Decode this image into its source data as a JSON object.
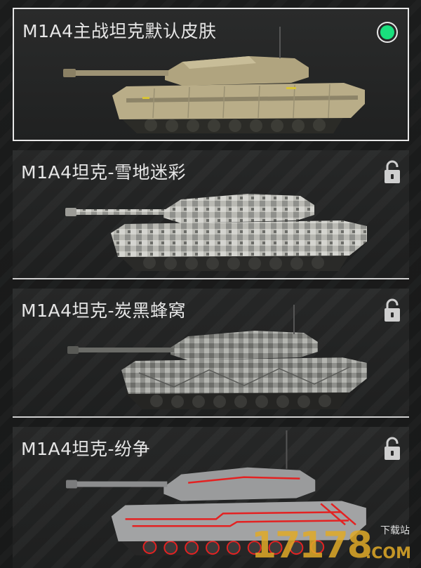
{
  "skins": [
    {
      "name": "M1A4主战坦克默认皮肤",
      "state": "selected",
      "camo": "desert"
    },
    {
      "name": "M1A4坦克-雪地迷彩",
      "state": "locked",
      "camo": "snow-digital"
    },
    {
      "name": "M1A4坦克-炭黑蜂窝",
      "state": "locked",
      "camo": "charcoal-honeycomb"
    },
    {
      "name": "M1A4坦克-纷争",
      "state": "locked",
      "camo": "strife-red-lines"
    }
  ],
  "colors": {
    "selected_indicator": "#19e07d",
    "selected_border": "#e7e7e7",
    "desert_hull": "#b9ad88",
    "snow_hull": "#b9b9b3",
    "charcoal_hull": "#8f908c",
    "strife_hull": "#a2a3a4",
    "strife_accent": "#e32222",
    "watermark": "#e1aa28"
  },
  "icons": {
    "selected": "radio-selected-icon",
    "locked": "padlock-icon"
  },
  "watermark": {
    "number": "17178",
    "site": "下载站",
    "domain": ".COM"
  }
}
